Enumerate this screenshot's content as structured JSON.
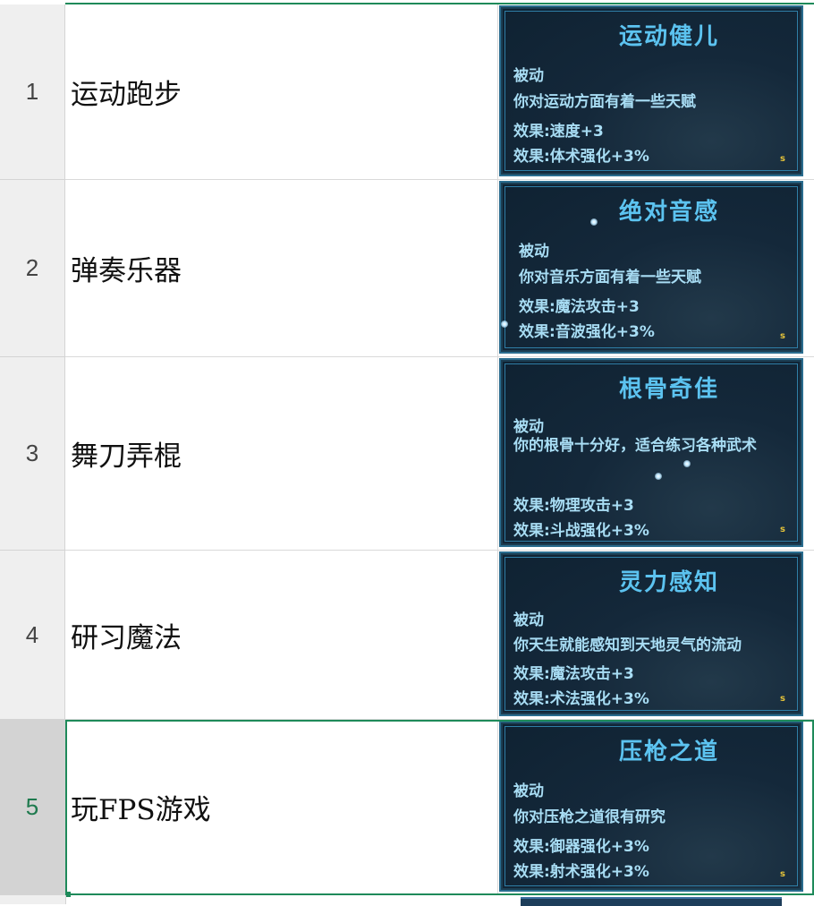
{
  "rows": [
    {
      "num": "1",
      "name": "运动跑步",
      "card": {
        "title": "运动健儿",
        "type": "被动",
        "desc": "你对运动方面有着一些天赋",
        "effect1": "效果:速度+3",
        "effect2": "效果:体术强化+3%",
        "badge": "s"
      }
    },
    {
      "num": "2",
      "name": "弹奏乐器",
      "card": {
        "title": "绝对音感",
        "type": "被动",
        "desc": "你对音乐方面有着一些天赋",
        "effect1": "效果:魔法攻击+3",
        "effect2": "效果:音波强化+3%",
        "badge": "s"
      }
    },
    {
      "num": "3",
      "name": "舞刀弄棍",
      "card": {
        "title": "根骨奇佳",
        "type": "被动",
        "desc": "你的根骨十分好，适合练习各种武术",
        "effect1": "效果:物理攻击+3",
        "effect2": "效果:斗战强化+3%",
        "badge": "s"
      }
    },
    {
      "num": "4",
      "name": "研习魔法",
      "card": {
        "title": "灵力感知",
        "type": "被动",
        "desc": "你天生就能感知到天地灵气的流动",
        "effect1": "效果:魔法攻击+3",
        "effect2": "效果:术法强化+3%",
        "badge": "s"
      }
    },
    {
      "num": "5",
      "name": "玩FPS游戏",
      "card": {
        "title": "压枪之道",
        "type": "被动",
        "desc": "你对压枪之道很有研究",
        "effect1": "效果:御器强化+3%",
        "effect2": "效果:射术强化+3%",
        "badge": "s"
      }
    }
  ],
  "colors": {
    "selection": "#1e8a5a",
    "card_bg": "#14283a",
    "card_text": "#7fd0f2"
  }
}
